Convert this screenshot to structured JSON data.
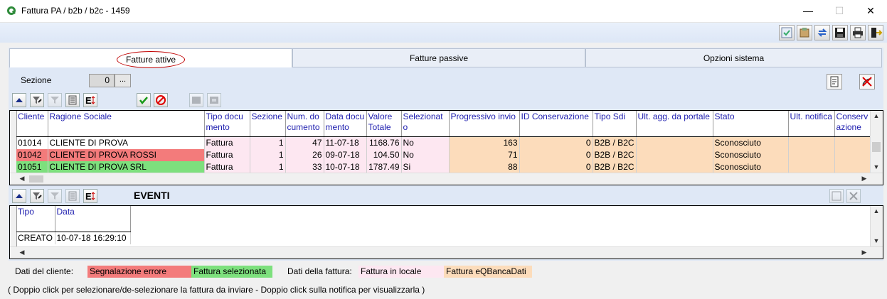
{
  "window": {
    "title": "Fattura PA / b2b / b2c - 1459",
    "minimize": "—",
    "maximize": "☐",
    "close": "✕"
  },
  "toolbar": {
    "icons": [
      "refresh-icon",
      "export-icon",
      "sync-icon",
      "save-icon",
      "print-icon",
      "exit-icon"
    ]
  },
  "tabs": [
    {
      "label": "Fatture attive",
      "active": true
    },
    {
      "label": "Fatture passive",
      "active": false
    },
    {
      "label": "Opzioni sistema",
      "active": false
    }
  ],
  "sezione": {
    "label": "Sezione",
    "value": "0",
    "lookup": "..."
  },
  "fatture_grid": {
    "columns": [
      "Cliente",
      "Ragione Sociale",
      "Tipo documento",
      "Sezione",
      "Num. documento",
      "Data documento",
      "Valore Totale",
      "Selezionato",
      "Progressivo invio",
      "ID Conservazione",
      "Tipo Sdi",
      "Ult. agg. da portale",
      "Stato",
      "Ult. notifica",
      "Conservazione"
    ],
    "rows": [
      {
        "cliente": "01014",
        "ragione": "CLIENTE DI PROVA",
        "tipo": "Fattura",
        "sezione": "1",
        "num": "47",
        "data": "11-07-18",
        "valore": "1168.76",
        "sel": "No",
        "prog": "163",
        "idcons": "0",
        "sdi": "B2B / B2C",
        "ultagg": "",
        "stato": "Sconosciuto",
        "notifica": "",
        "cons": "",
        "status": "none"
      },
      {
        "cliente": "01042",
        "ragione": "CLIENTE DI PROVA ROSSI",
        "tipo": "Fattura",
        "sezione": "1",
        "num": "26",
        "data": "09-07-18",
        "valore": "104.50",
        "sel": "No",
        "prog": "71",
        "idcons": "0",
        "sdi": "B2B / B2C",
        "ultagg": "",
        "stato": "Sconosciuto",
        "notifica": "",
        "cons": "",
        "status": "error"
      },
      {
        "cliente": "01051",
        "ragione": "CLIENTE DI PROVA SRL",
        "tipo": "Fattura",
        "sezione": "1",
        "num": "33",
        "data": "10-07-18",
        "valore": "1787.49",
        "sel": "Si",
        "prog": "88",
        "idcons": "0",
        "sdi": "B2B / B2C",
        "ultagg": "",
        "stato": "Sconosciuto",
        "notifica": "",
        "cons": "",
        "status": "selected"
      }
    ]
  },
  "eventi": {
    "title": "EVENTI",
    "columns": [
      "Tipo",
      "Data"
    ],
    "rows": [
      {
        "tipo": "CREATO",
        "data": "10-07-18 16:29:10"
      }
    ]
  },
  "legend": {
    "cliente_label": "Dati del cliente:",
    "errore": "Segnalazione errore",
    "selezionata": "Fattura selezionata",
    "fattura_label": "Dati della fattura:",
    "locale": "Fattura in locale",
    "banca": "Fattura eQBancaDati"
  },
  "hint": "( Doppio click per selezionare/de-selezionare la fattura da inviare - Doppio click sulla notifica per visualizzarla )",
  "colors": {
    "error": "#f37b7b",
    "selected": "#7de07d",
    "locale": "#fde7f1",
    "banca": "#fcdcbb",
    "header_text": "#1c1cae"
  }
}
